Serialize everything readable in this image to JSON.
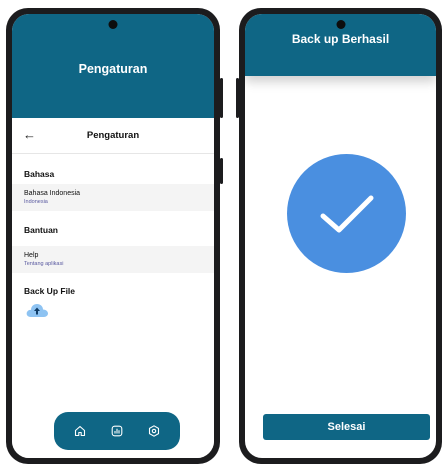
{
  "left_screen": {
    "header_title": "Pengaturan",
    "nav_title": "Pengaturan",
    "back_icon": "←",
    "sections": {
      "bahasa": {
        "title": "Bahasa",
        "item_label": "Bahasa Indonesia",
        "item_value": "Indonesia"
      },
      "bantuan": {
        "title": "Bantuan",
        "item_label": "Help",
        "item_value": "Tentang aplikasi"
      },
      "backup": {
        "title": "Back Up File",
        "icon": "cloud-upload-icon"
      }
    },
    "bottom_nav": {
      "items": [
        "home-icon",
        "chart-icon",
        "settings-icon"
      ]
    }
  },
  "right_screen": {
    "header_title": "Back up Berhasil",
    "status_icon": "check-icon",
    "done_label": "Selesai"
  },
  "colors": {
    "primary": "#0f6685",
    "success_circle": "#4a8fe0",
    "item_background": "#f4f4f4",
    "sub_text": "#5a5aa0"
  }
}
